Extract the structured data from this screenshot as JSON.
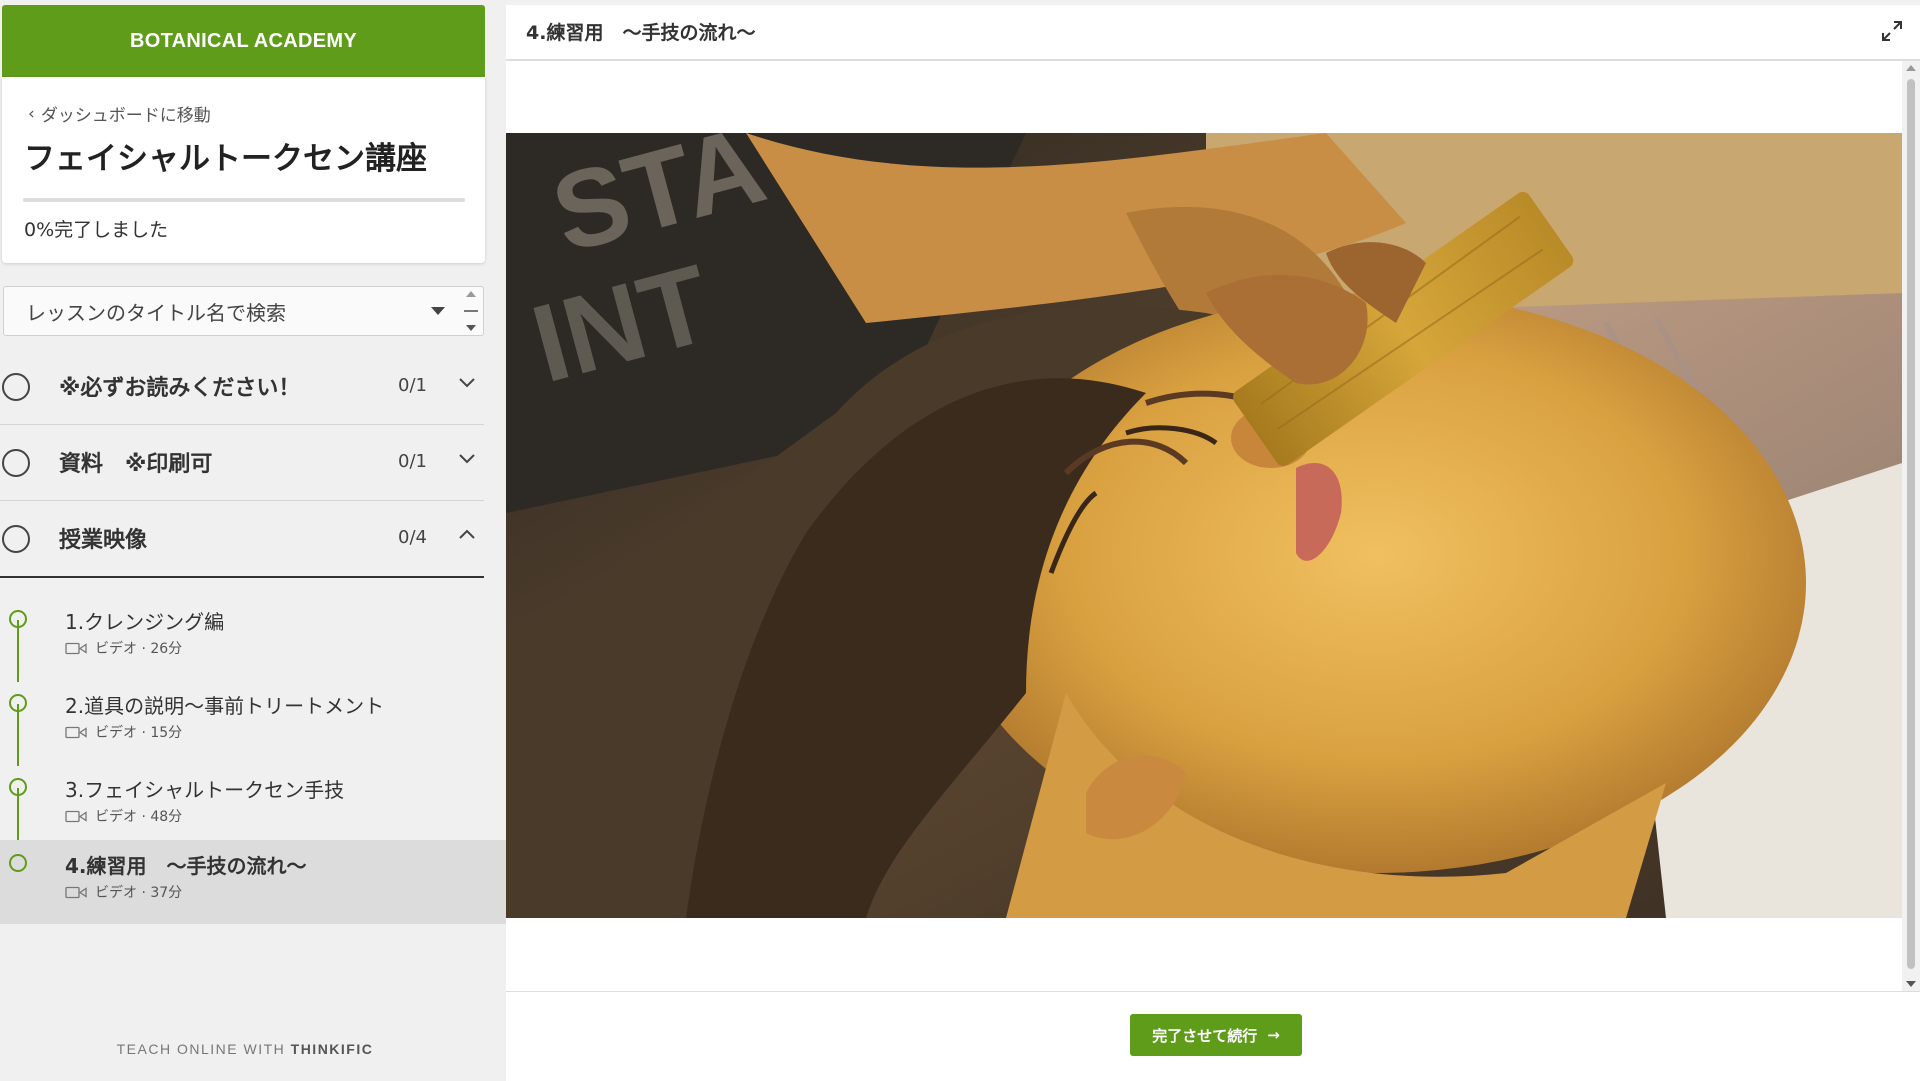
{
  "brand": {
    "name": "BOTANICAL ACADEMY",
    "color": "#5f9c19"
  },
  "course": {
    "back_label": "ダッシュボードに移動",
    "title": "フェイシャルトークセン講座",
    "progress_percent": 0,
    "progress_text": "0%完了しました"
  },
  "search": {
    "placeholder": "レッスンのタイトル名で検索"
  },
  "chapters": [
    {
      "title": "※必ずお読みください！",
      "count": "0/1",
      "expanded": false
    },
    {
      "title": "資料　※印刷可",
      "count": "0/1",
      "expanded": false
    },
    {
      "title": "授業映像",
      "count": "0/4",
      "expanded": true
    }
  ],
  "lessons": [
    {
      "title": "1.クレンジング編",
      "meta": "ビデオ · 26分",
      "active": false
    },
    {
      "title": "2.道具の説明〜事前トリートメント",
      "meta": "ビデオ · 15分",
      "active": false
    },
    {
      "title": "3.フェイシャルトークセン手技",
      "meta": "ビデオ · 48分",
      "active": false
    },
    {
      "title": "4.練習用　〜手技の流れ〜",
      "meta": "ビデオ · 37分",
      "active": true
    }
  ],
  "footer": {
    "prefix": "TEACH ONLINE WITH",
    "brand": "THINKIFIC"
  },
  "main": {
    "lesson_title": "4.練習用　〜手技の流れ〜",
    "complete_button": "完了させて続行",
    "complete_arrow": "→"
  },
  "icons": {
    "back": "chevron-left-icon",
    "dropdown": "caret-down-icon",
    "chapter_collapsed": "chevron-down-icon",
    "chapter_expanded": "chevron-up-icon",
    "video": "video-camera-icon",
    "expand": "fullscreen-expand-icon"
  }
}
